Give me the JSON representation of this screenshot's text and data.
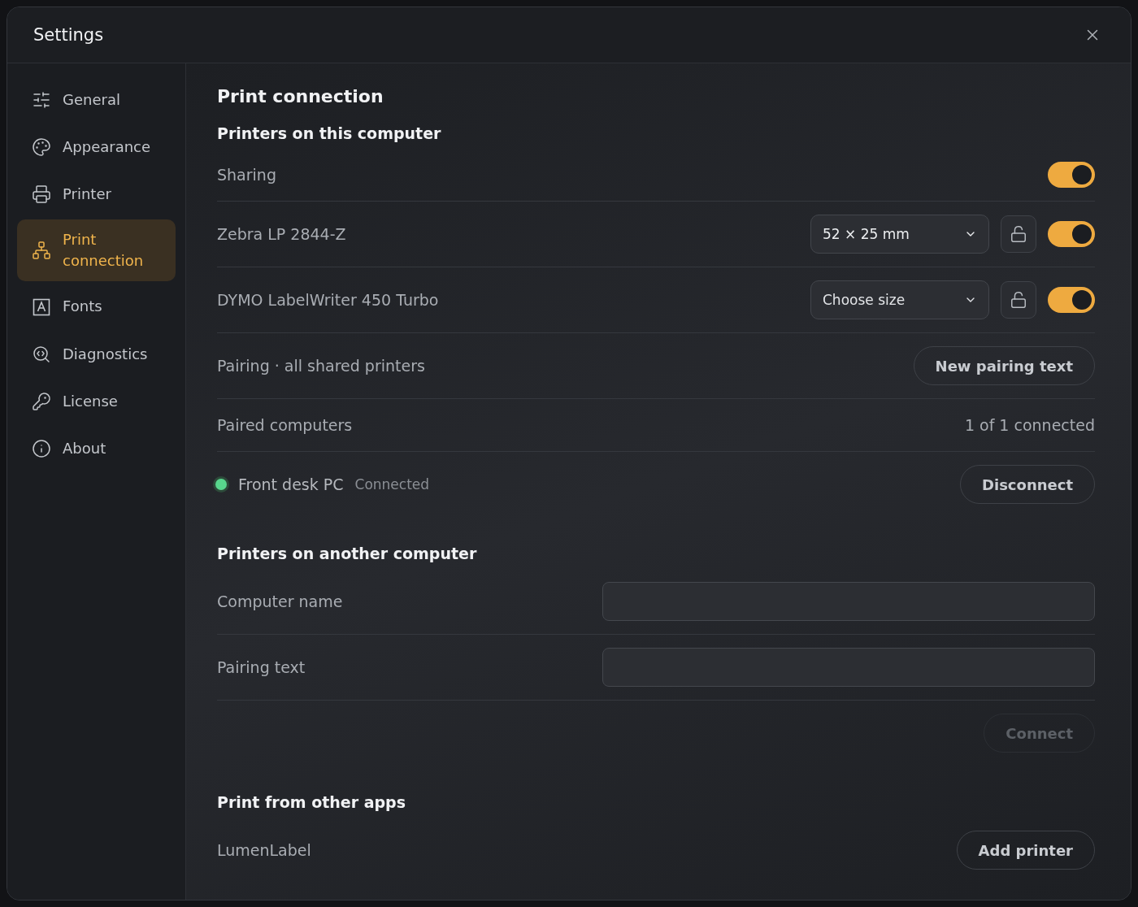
{
  "window": {
    "title": "Settings"
  },
  "sidebar": {
    "items": [
      {
        "label": "General",
        "selected": false
      },
      {
        "label": "Appearance",
        "selected": false
      },
      {
        "label": "Printer",
        "selected": false
      },
      {
        "label": "Print connection",
        "selected": true
      },
      {
        "label": "Fonts",
        "selected": false
      },
      {
        "label": "Diagnostics",
        "selected": false
      },
      {
        "label": "License",
        "selected": false
      },
      {
        "label": "About",
        "selected": false
      }
    ]
  },
  "content": {
    "title": "Print connection",
    "sections": [
      {
        "heading": "Printers on this computer",
        "rows": [
          {
            "kind": "toggle",
            "label": "Sharing",
            "on": true
          },
          {
            "kind": "printer",
            "label": "Zebra LP 2844-Z",
            "value": "52 × 25 mm",
            "on": true
          },
          {
            "kind": "printer",
            "label": "DYMO LabelWriter 450 Turbo",
            "placeholder": "Choose size",
            "on": true
          },
          {
            "kind": "action",
            "label": "Pairing · all shared printers",
            "button": "New pairing text",
            "disabled": false
          },
          {
            "kind": "info",
            "label": "Paired computers",
            "value": "1 of 1 connected"
          },
          {
            "kind": "computer",
            "label": "Front desk PC",
            "status": "Connected",
            "connected": true,
            "button": "Disconnect"
          }
        ]
      },
      {
        "heading": "Printers on another computer",
        "rows": [
          {
            "kind": "field",
            "label": "Computer name"
          },
          {
            "kind": "field",
            "label": "Pairing text"
          },
          {
            "kind": "submit",
            "button": "Connect",
            "disabled": true
          }
        ]
      },
      {
        "heading": "Print from other apps",
        "rows": [
          {
            "kind": "action",
            "label": "LumenLabel",
            "button": "Add printer",
            "disabled": false
          }
        ]
      }
    ]
  }
}
